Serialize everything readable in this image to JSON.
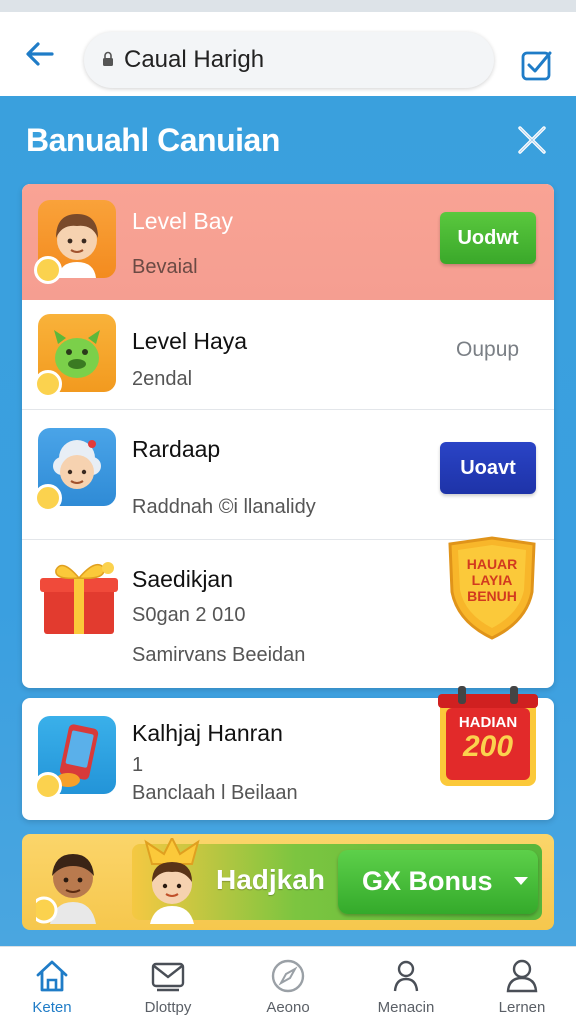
{
  "browser": {
    "url": "Caual Harigh"
  },
  "panel": {
    "title": "Banuahl Canuian"
  },
  "items": [
    {
      "title": "Level Bay",
      "subtitle": "Bevaial",
      "action": "Uodwt"
    },
    {
      "title": "Level Haya",
      "subtitle": "2endal",
      "action": "Oupup"
    },
    {
      "title": "Rardaap",
      "subtitle": "Raddnah ©i llanalidy",
      "action": "Uoavt"
    },
    {
      "title": "Saedikjan",
      "subtitle": "S0gan 2 010",
      "subtitle2": "Samirvans Beeidan",
      "badge_lines": [
        "HAUAR",
        "LAYIA",
        "BENUH"
      ]
    },
    {
      "title": "Kalhjaj Hanran",
      "subtitle": "1",
      "subtitle2": "Banclaah l Beilaan",
      "badge_lines": [
        "HADIAN",
        "200"
      ]
    }
  ],
  "bonus": {
    "text": "Hadjkah",
    "button_label": "GX Bonus"
  },
  "nav": [
    {
      "label": "Keten",
      "icon": "home-icon",
      "active": true
    },
    {
      "label": "Dlottpy",
      "icon": "mail-icon",
      "active": false
    },
    {
      "label": "Aeono",
      "icon": "compass-icon",
      "active": false
    },
    {
      "label": "Menacin",
      "icon": "person-icon",
      "active": false
    },
    {
      "label": "Lernen",
      "icon": "profile-icon",
      "active": false
    }
  ],
  "colors": {
    "accent": "#1f7cc7",
    "panel_blue": "#3aa0dd",
    "highlight_row": "#f9a394",
    "green_button": "#4bbb35",
    "blue_button": "#2a44c6",
    "bonus_yellow": "#f6c74d"
  }
}
